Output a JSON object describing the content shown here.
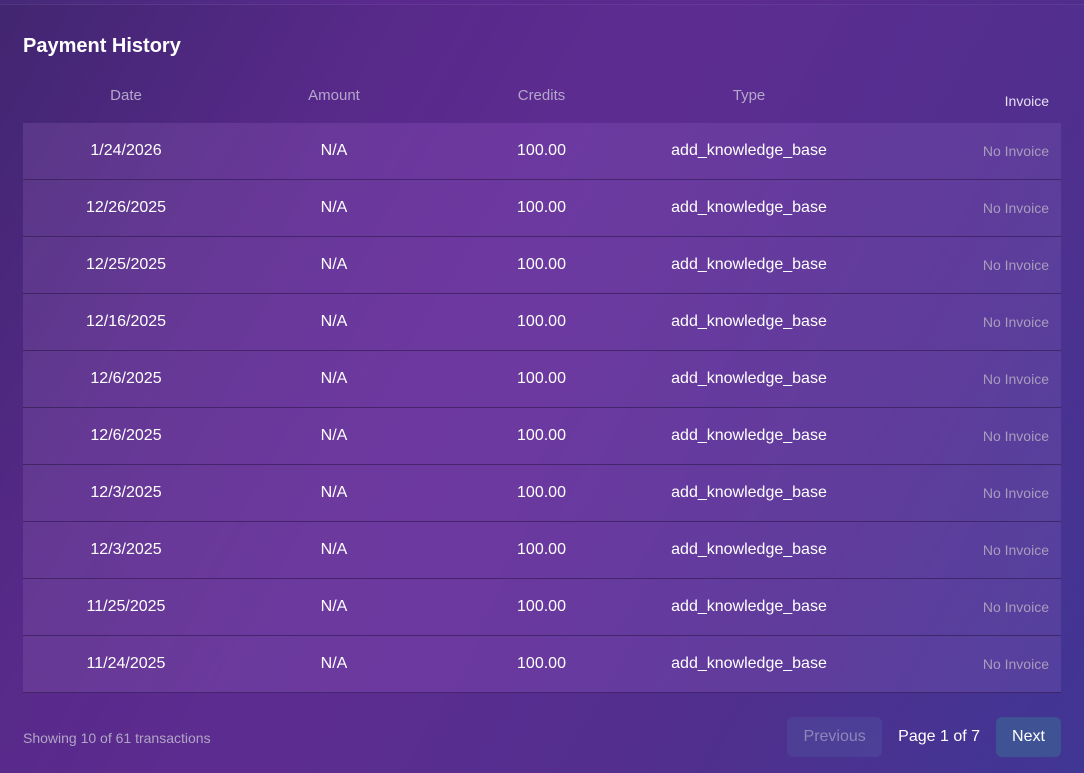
{
  "title": "Payment History",
  "columns": {
    "date": "Date",
    "amount": "Amount",
    "credits": "Credits",
    "type": "Type",
    "invoice": "Invoice"
  },
  "rows": [
    {
      "date": "1/24/2026",
      "amount": "N/A",
      "credits": "100.00",
      "type": "add_knowledge_base",
      "invoice": "No Invoice"
    },
    {
      "date": "12/26/2025",
      "amount": "N/A",
      "credits": "100.00",
      "type": "add_knowledge_base",
      "invoice": "No Invoice"
    },
    {
      "date": "12/25/2025",
      "amount": "N/A",
      "credits": "100.00",
      "type": "add_knowledge_base",
      "invoice": "No Invoice"
    },
    {
      "date": "12/16/2025",
      "amount": "N/A",
      "credits": "100.00",
      "type": "add_knowledge_base",
      "invoice": "No Invoice"
    },
    {
      "date": "12/6/2025",
      "amount": "N/A",
      "credits": "100.00",
      "type": "add_knowledge_base",
      "invoice": "No Invoice"
    },
    {
      "date": "12/6/2025",
      "amount": "N/A",
      "credits": "100.00",
      "type": "add_knowledge_base",
      "invoice": "No Invoice"
    },
    {
      "date": "12/3/2025",
      "amount": "N/A",
      "credits": "100.00",
      "type": "add_knowledge_base",
      "invoice": "No Invoice"
    },
    {
      "date": "12/3/2025",
      "amount": "N/A",
      "credits": "100.00",
      "type": "add_knowledge_base",
      "invoice": "No Invoice"
    },
    {
      "date": "11/25/2025",
      "amount": "N/A",
      "credits": "100.00",
      "type": "add_knowledge_base",
      "invoice": "No Invoice"
    },
    {
      "date": "11/24/2025",
      "amount": "N/A",
      "credits": "100.00",
      "type": "add_knowledge_base",
      "invoice": "No Invoice"
    }
  ],
  "footer": {
    "showing": "Showing 10 of 61 transactions",
    "previous_label": "Previous",
    "page_label": "Page 1 of 7",
    "next_label": "Next"
  }
}
